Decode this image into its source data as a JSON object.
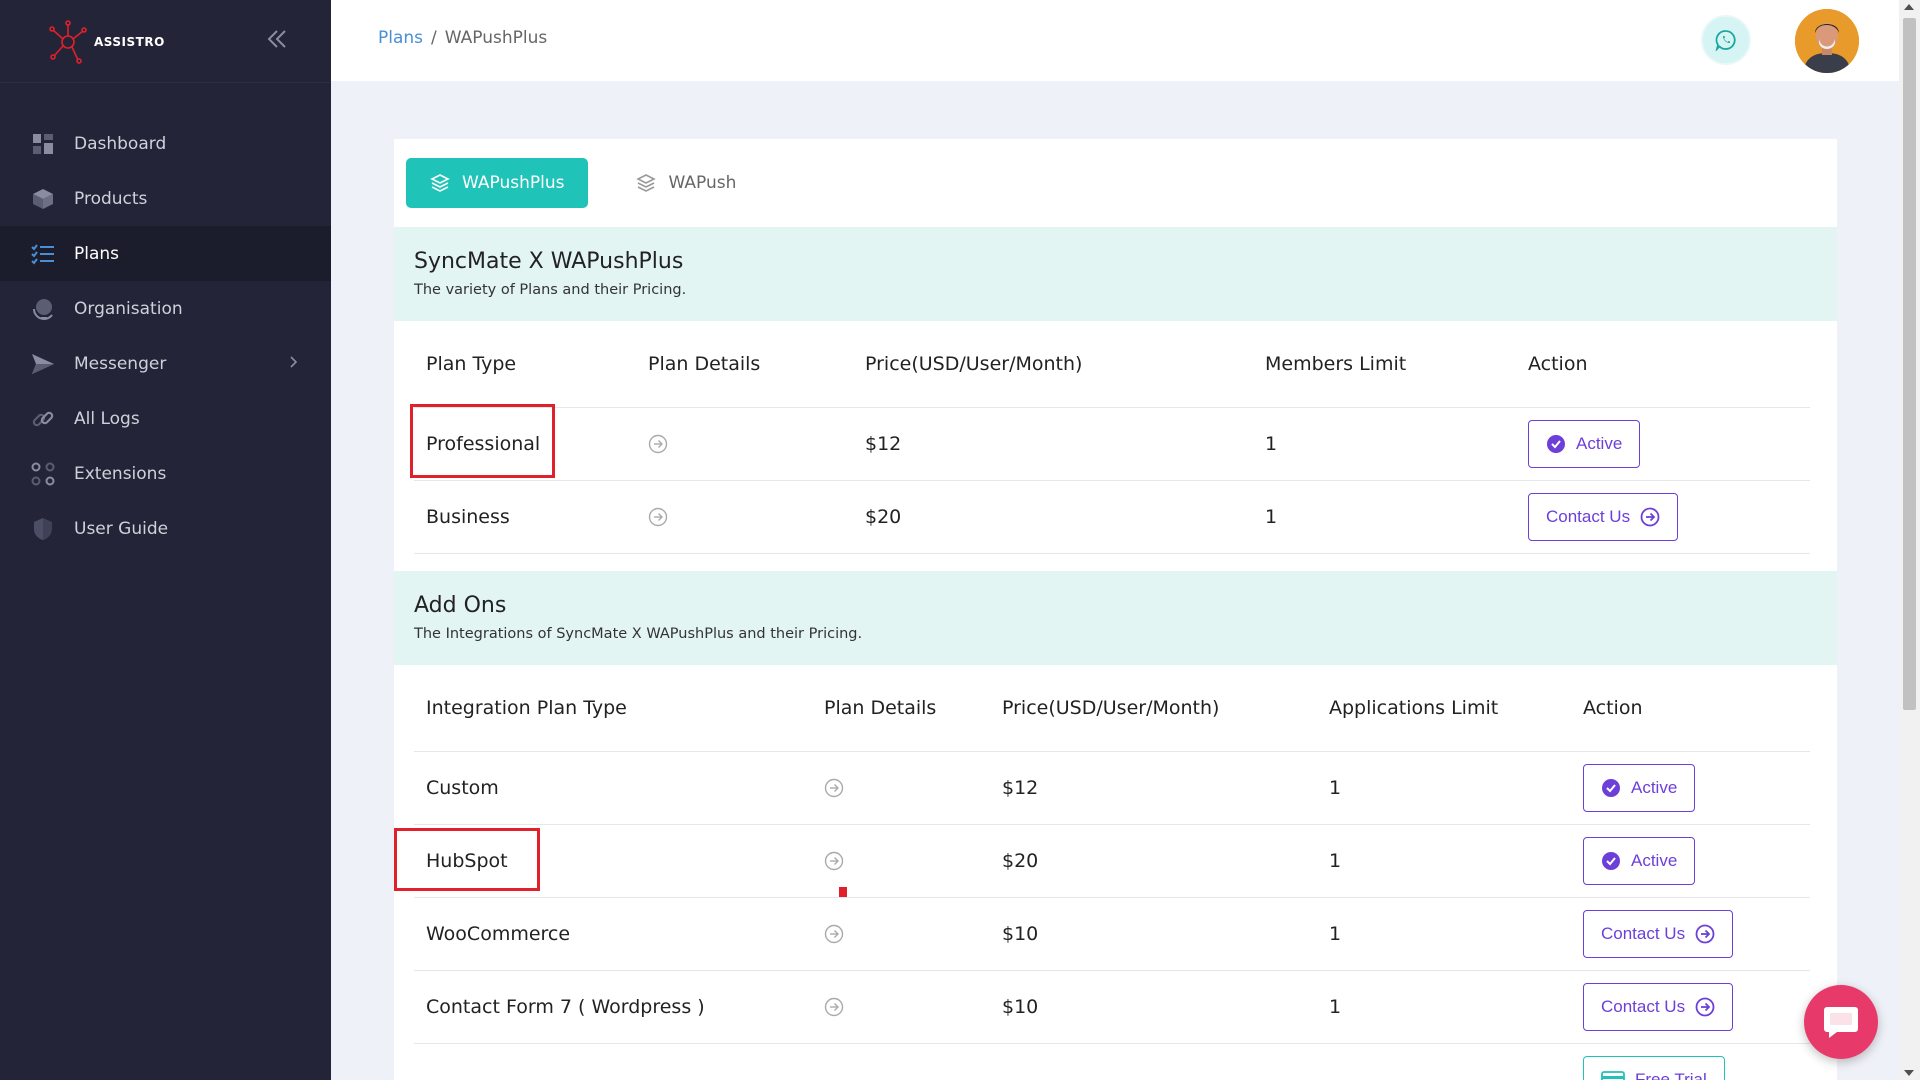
{
  "brand": {
    "name": "ASSISTRO"
  },
  "sidebar": {
    "items": [
      {
        "label": "Dashboard",
        "icon": "dashboard-icon"
      },
      {
        "label": "Products",
        "icon": "cube-icon"
      },
      {
        "label": "Plans",
        "icon": "list-check-icon",
        "active": true
      },
      {
        "label": "Organisation",
        "icon": "globe-icon"
      },
      {
        "label": "Messenger",
        "icon": "send-icon",
        "has_submenu": true
      },
      {
        "label": "All Logs",
        "icon": "link-icon"
      },
      {
        "label": "Extensions",
        "icon": "grid-dots-icon"
      },
      {
        "label": "User Guide",
        "icon": "shield-icon"
      }
    ]
  },
  "header": {
    "breadcrumb": {
      "parent": "Plans",
      "separator": "/",
      "current": "WAPushPlus"
    }
  },
  "tabs": [
    {
      "label": "WAPushPlus",
      "active": true
    },
    {
      "label": "WAPush",
      "active": false
    }
  ],
  "plans_section": {
    "title": "SyncMate X WAPushPlus",
    "subtitle": "The variety of Plans and their Pricing.",
    "columns": [
      "Plan Type",
      "Plan Details",
      "Price(USD/User/Month)",
      "Members Limit",
      "Action"
    ],
    "rows": [
      {
        "type": "Professional",
        "price": "$12",
        "limit": "1",
        "action": "Active"
      },
      {
        "type": "Business",
        "price": "$20",
        "limit": "1",
        "action": "Contact Us"
      }
    ]
  },
  "addons_section": {
    "title": "Add Ons",
    "subtitle": "The Integrations of SyncMate X WAPushPlus and their Pricing.",
    "columns": [
      "Integration Plan Type",
      "Plan Details",
      "Price(USD/User/Month)",
      "Applications Limit",
      "Action"
    ],
    "rows": [
      {
        "type": "Custom",
        "price": "$12",
        "limit": "1",
        "action": "Active"
      },
      {
        "type": "HubSpot",
        "price": "$20",
        "limit": "1",
        "action": "Active"
      },
      {
        "type": "WooCommerce",
        "price": "$10",
        "limit": "1",
        "action": "Contact Us"
      },
      {
        "type": "Contact Form 7 ( Wordpress )",
        "price": "$10",
        "limit": "1",
        "action": "Contact Us"
      }
    ],
    "partial_action": "Free Trial"
  },
  "colors": {
    "sidebar_bg": "#232437",
    "accent_teal": "#20c3b8",
    "accent_purple": "#6d3fd9",
    "highlight_red": "#e0212b"
  }
}
